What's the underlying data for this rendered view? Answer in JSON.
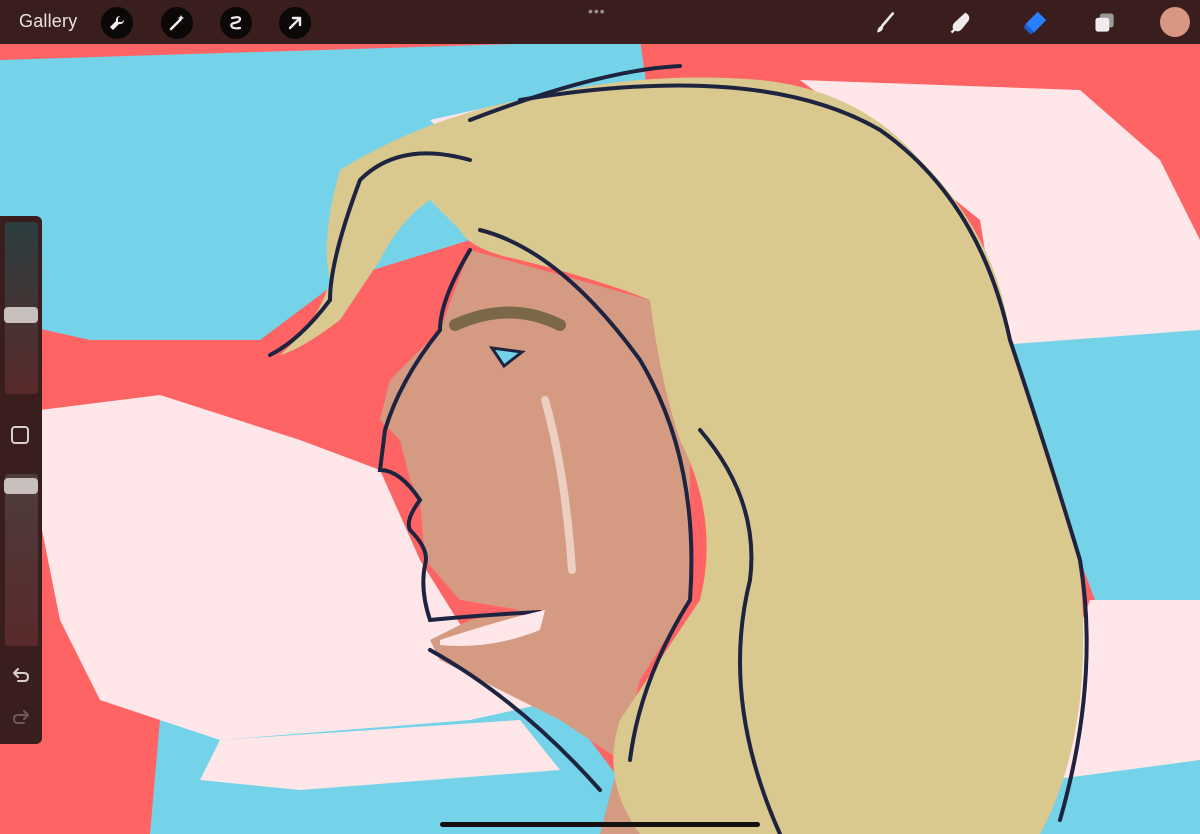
{
  "topbar": {
    "gallery_label": "Gallery",
    "left_tools": [
      {
        "name": "wrench-icon"
      },
      {
        "name": "magic-wand-icon"
      },
      {
        "name": "selection-icon"
      },
      {
        "name": "move-arrow-icon"
      }
    ],
    "right_tools": [
      {
        "name": "brush-icon"
      },
      {
        "name": "smudge-icon"
      },
      {
        "name": "eraser-icon",
        "active": true
      },
      {
        "name": "layers-icon"
      }
    ],
    "current_color": "#d79782"
  },
  "sidebar": {
    "brush_size_level": 0.3,
    "opacity_level": 0.15
  },
  "colors": {
    "bar": "#3a1e1e",
    "active_tool": "#2a7fff",
    "canvas_red": "#ff6464",
    "canvas_blue": "#74d3e8",
    "canvas_cloud": "#ffe6e8",
    "hair": "#d9c98f",
    "skin": "#d49a82",
    "line": "#1e2440"
  }
}
